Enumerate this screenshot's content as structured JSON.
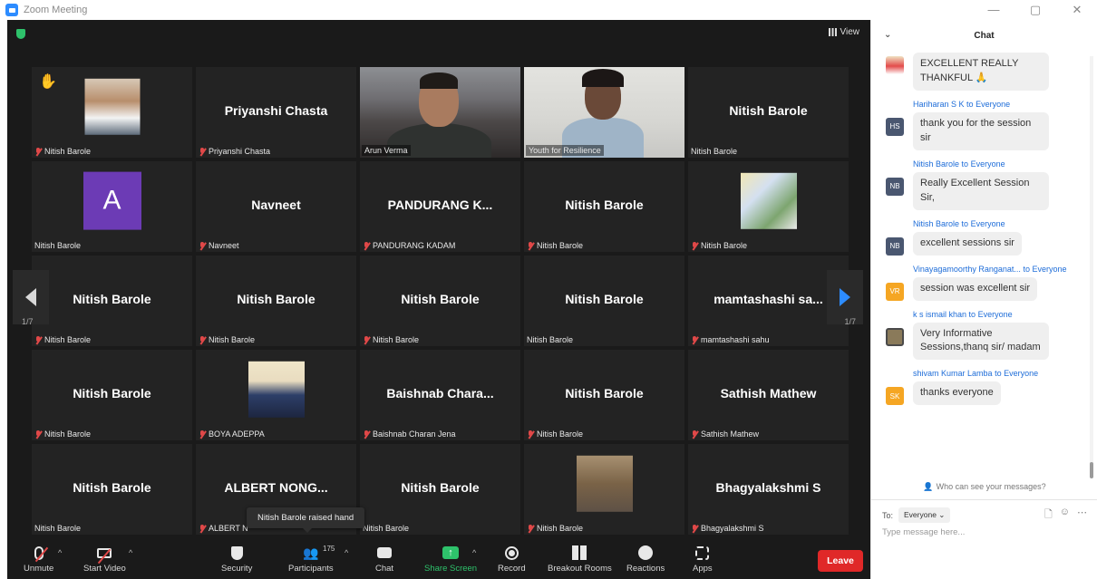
{
  "window": {
    "title": "Zoom Meeting",
    "controls": [
      "—",
      "▢",
      "✕"
    ]
  },
  "meeting": {
    "view_label": "View",
    "page_indicator_left": "1/7",
    "page_indicator_right": "1/7",
    "toast": "Nitish Barole raised hand",
    "tiles": [
      {
        "display": "",
        "label": "Nitish Barole",
        "muted": true,
        "thumb": "p1",
        "hand": true
      },
      {
        "display": "Priyanshi Chasta",
        "label": "Priyanshi Chasta",
        "muted": true
      },
      {
        "display": "",
        "label": "Arun Verma",
        "muted": false,
        "video": "vid1",
        "active": true
      },
      {
        "display": "",
        "label": "Youth for Resilience",
        "muted": false,
        "video": "vid2"
      },
      {
        "display": "Nitish Barole",
        "label": "Nitish Barole",
        "muted": false
      },
      {
        "display": "",
        "label": "Nitish Barole",
        "muted": false,
        "avatar": "A"
      },
      {
        "display": "Navneet",
        "label": "Navneet",
        "muted": true
      },
      {
        "display": "PANDURANG  K...",
        "label": "PANDURANG KADAM",
        "muted": true
      },
      {
        "display": "Nitish Barole",
        "label": "Nitish Barole",
        "muted": true
      },
      {
        "display": "",
        "label": "Nitish Barole",
        "muted": true,
        "thumb": "p2"
      },
      {
        "display": "Nitish Barole",
        "label": "Nitish Barole",
        "muted": true
      },
      {
        "display": "Nitish Barole",
        "label": "Nitish Barole",
        "muted": true
      },
      {
        "display": "Nitish Barole",
        "label": "Nitish Barole",
        "muted": true
      },
      {
        "display": "Nitish Barole",
        "label": "Nitish Barole",
        "muted": false
      },
      {
        "display": "mamtashashi  sa...",
        "label": "mamtashashi sahu",
        "muted": true
      },
      {
        "display": "Nitish Barole",
        "label": "Nitish Barole",
        "muted": true
      },
      {
        "display": "",
        "label": "BOYA ADEPPA",
        "muted": true,
        "thumb": "p3"
      },
      {
        "display": "Baishnab  Chara...",
        "label": "Baishnab Charan Jena",
        "muted": true
      },
      {
        "display": "Nitish Barole",
        "label": "Nitish Barole",
        "muted": true
      },
      {
        "display": "Sathish Mathew",
        "label": "Sathish Mathew",
        "muted": true
      },
      {
        "display": "Nitish Barole",
        "label": "Nitish Barole",
        "muted": false
      },
      {
        "display": "ALBERT  NONG...",
        "label": "ALBERT N",
        "muted": true
      },
      {
        "display": "Nitish Barole",
        "label": "Nitish Barole",
        "muted": false
      },
      {
        "display": "",
        "label": "Nitish Barole",
        "muted": true,
        "thumb": "p4"
      },
      {
        "display": "Bhagyalakshmi S",
        "label": "Bhagyalakshmi S",
        "muted": true
      }
    ]
  },
  "toolbar": {
    "unmute": "Unmute",
    "start_video": "Start Video",
    "security": "Security",
    "participants": "Participants",
    "participant_count": "175",
    "chat": "Chat",
    "share_screen": "Share Screen",
    "record": "Record",
    "breakout_rooms": "Breakout Rooms",
    "reactions": "Reactions",
    "apps": "Apps",
    "leave": "Leave"
  },
  "chat": {
    "title": "Chat",
    "messages": [
      {
        "sender": "",
        "to": "",
        "avatar_text": "",
        "avatar_kind": "logo",
        "text": "EXCELLENT REALLY THANKFUL 🙏"
      },
      {
        "sender": "Hariharan S K",
        "to": "Everyone",
        "avatar_text": "HS",
        "avatar_kind": "hs",
        "text": "thank you for the session sir"
      },
      {
        "sender": "Nitish Barole",
        "to": "Everyone",
        "avatar_text": "NB",
        "avatar_kind": "nb",
        "text": "Really Excellent Session Sir,"
      },
      {
        "sender": "Nitish Barole",
        "to": "Everyone",
        "avatar_text": "NB",
        "avatar_kind": "nb",
        "text": "excellent sessions sir"
      },
      {
        "sender": "Vinayagamoorthy Ranganat...",
        "to": "Everyone",
        "avatar_text": "VR",
        "avatar_kind": "vr",
        "text": "session was excellent sir"
      },
      {
        "sender": "k s ismail khan",
        "to": "Everyone",
        "avatar_text": "",
        "avatar_kind": "ks",
        "text": "Very Informative Sessions,thanq sir/ madam"
      },
      {
        "sender": "shivam Kumar Lamba",
        "to": "Everyone",
        "avatar_text": "SK",
        "avatar_kind": "sk",
        "text": "thanks everyone"
      }
    ],
    "to_word": "to",
    "visibility_note": "Who can see your messages?",
    "to_label": "To:",
    "recipient": "Everyone",
    "input_placeholder": "Type message here..."
  }
}
